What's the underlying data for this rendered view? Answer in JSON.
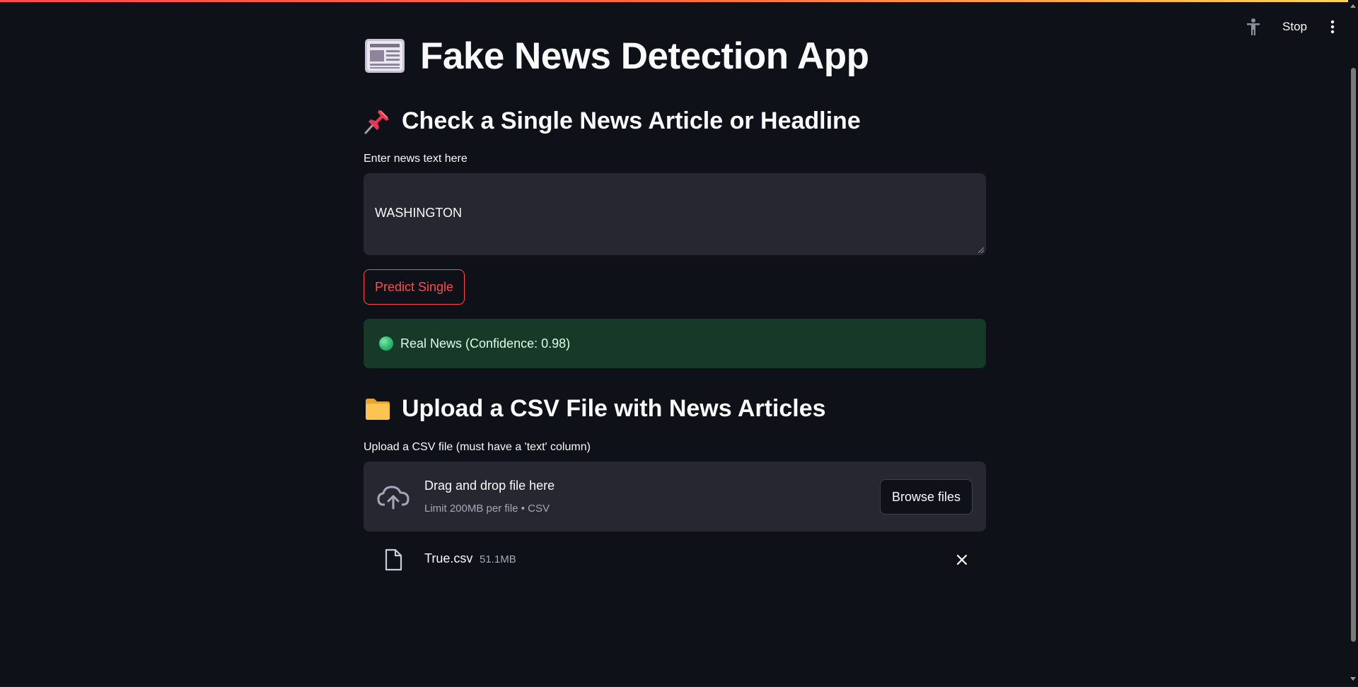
{
  "header": {
    "stop_label": "Stop"
  },
  "page": {
    "title": "Fake News Detection App",
    "title_icon": "newspaper-emoji"
  },
  "single_section": {
    "heading": "Check a Single News Article or Headline",
    "heading_icon": "pushpin-emoji",
    "input_label": "Enter news text here",
    "input_value": "WASHINGTON",
    "predict_button": "Predict Single",
    "result_text": "Real News (Confidence: 0.98)",
    "result_icon": "green-circle-emoji"
  },
  "upload_section": {
    "heading": "Upload a CSV File with News Articles",
    "heading_icon": "folder-emoji",
    "uploader_label": "Upload a CSV file (must have a 'text' column)",
    "dropzone_primary": "Drag and drop file here",
    "dropzone_secondary": "Limit 200MB per file • CSV",
    "browse_button": "Browse files",
    "file": {
      "name": "True.csv",
      "size": "51.1MB"
    }
  },
  "colors": {
    "background": "#0e1117",
    "accent": "#ff4b4b",
    "input_bg": "#262730",
    "success_bg": "#173928"
  }
}
